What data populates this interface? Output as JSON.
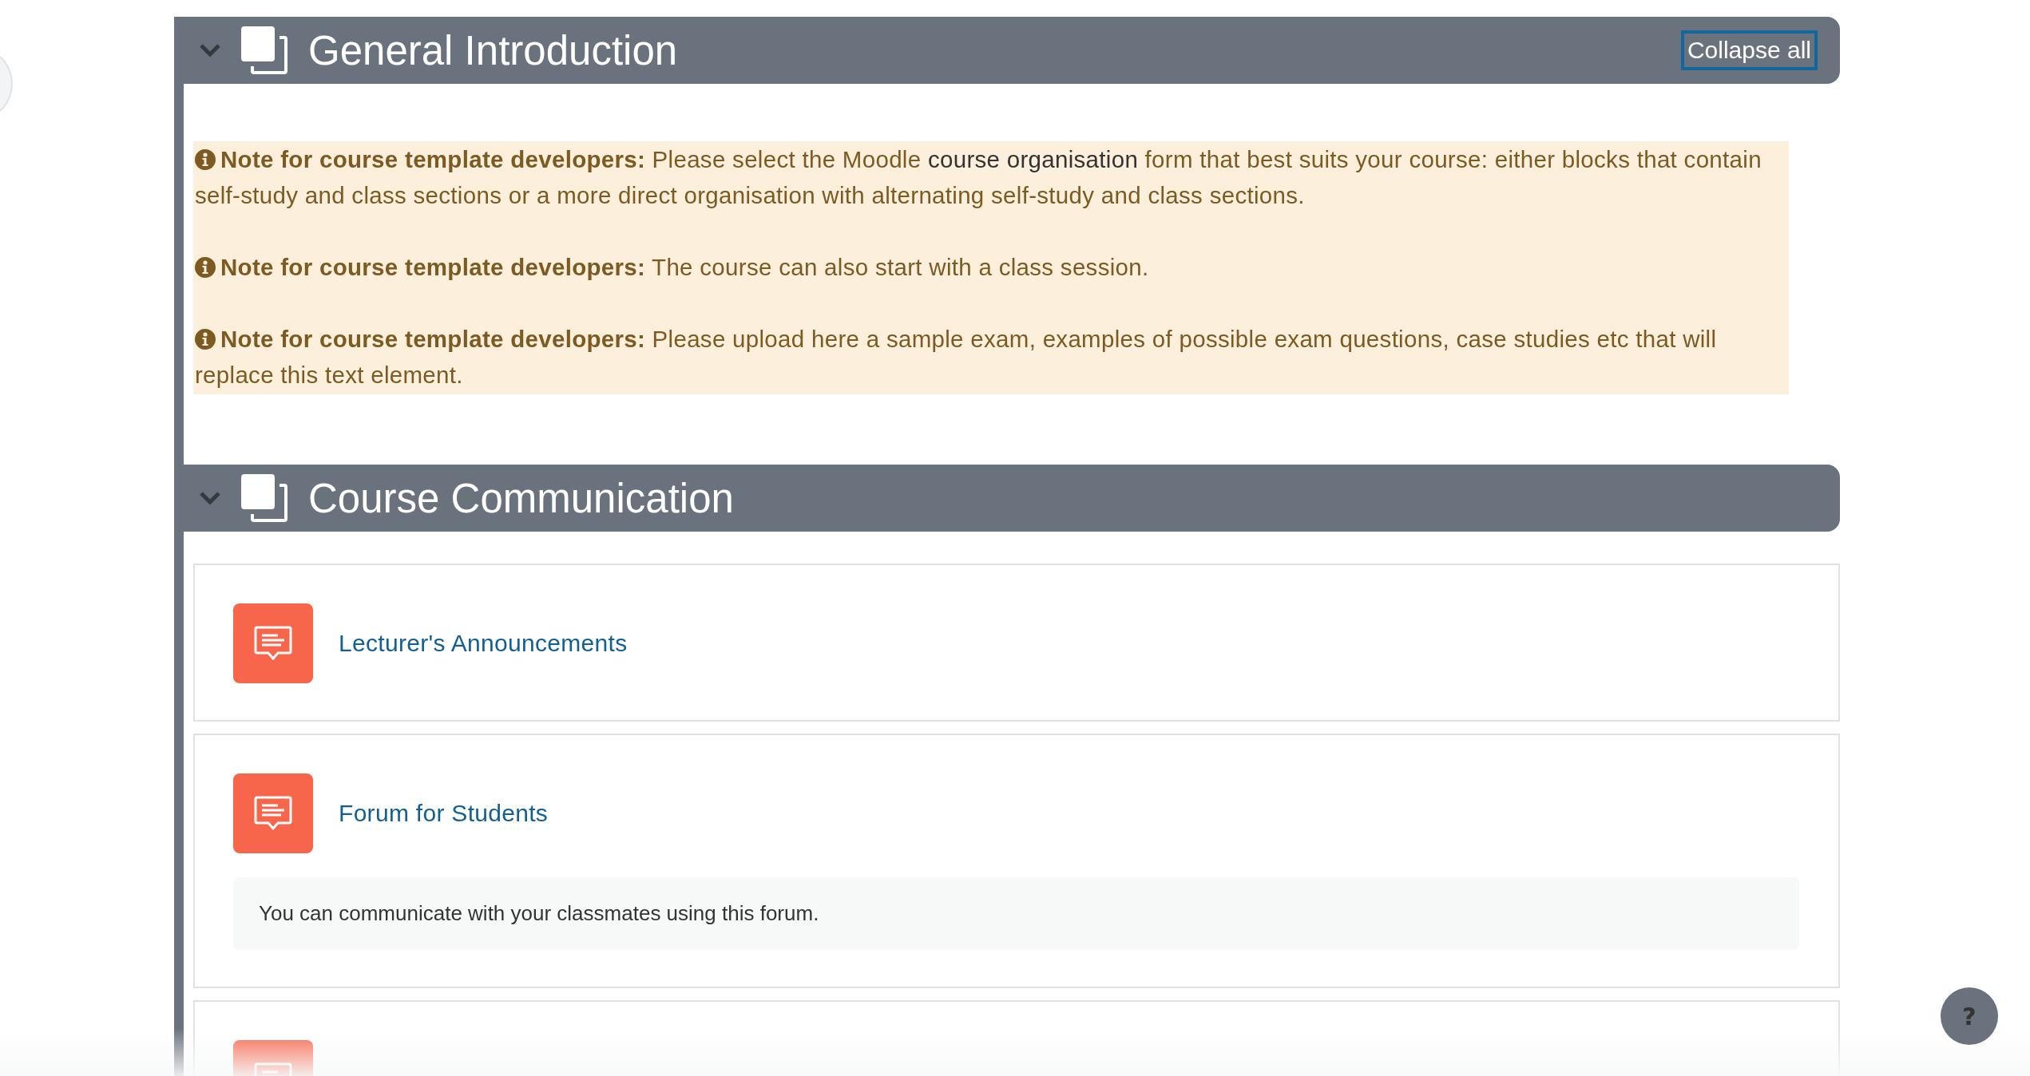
{
  "sections": [
    {
      "title": "General Introduction",
      "expanded": true,
      "collapse_all": "Collapse all",
      "notes": [
        {
          "text": "**Note for course template developers:** Please select the Moodle ",
          "link": "course organisation",
          "after": " form that best suits your course: either blocks that contain self-study and class sections or a more direct organisation with alternating self-study and class sections."
        },
        {
          "text": "**Note for course template developers:** The course can also start with a class session."
        },
        {
          "text": "**Note for course template developers:** Please upload here a sample exam, examples of possible exam questions, case studies etc that will replace this text element."
        }
      ]
    },
    {
      "title": "Course Communication",
      "expanded": true,
      "activities": [
        {
          "kind": "forum",
          "name": "Lecturer's Announcements"
        },
        {
          "kind": "forum",
          "name": "Forum for Students",
          "description": "You can communicate with your classmates using this forum."
        },
        {
          "kind": "forum"
        }
      ]
    }
  ],
  "help": "?"
}
